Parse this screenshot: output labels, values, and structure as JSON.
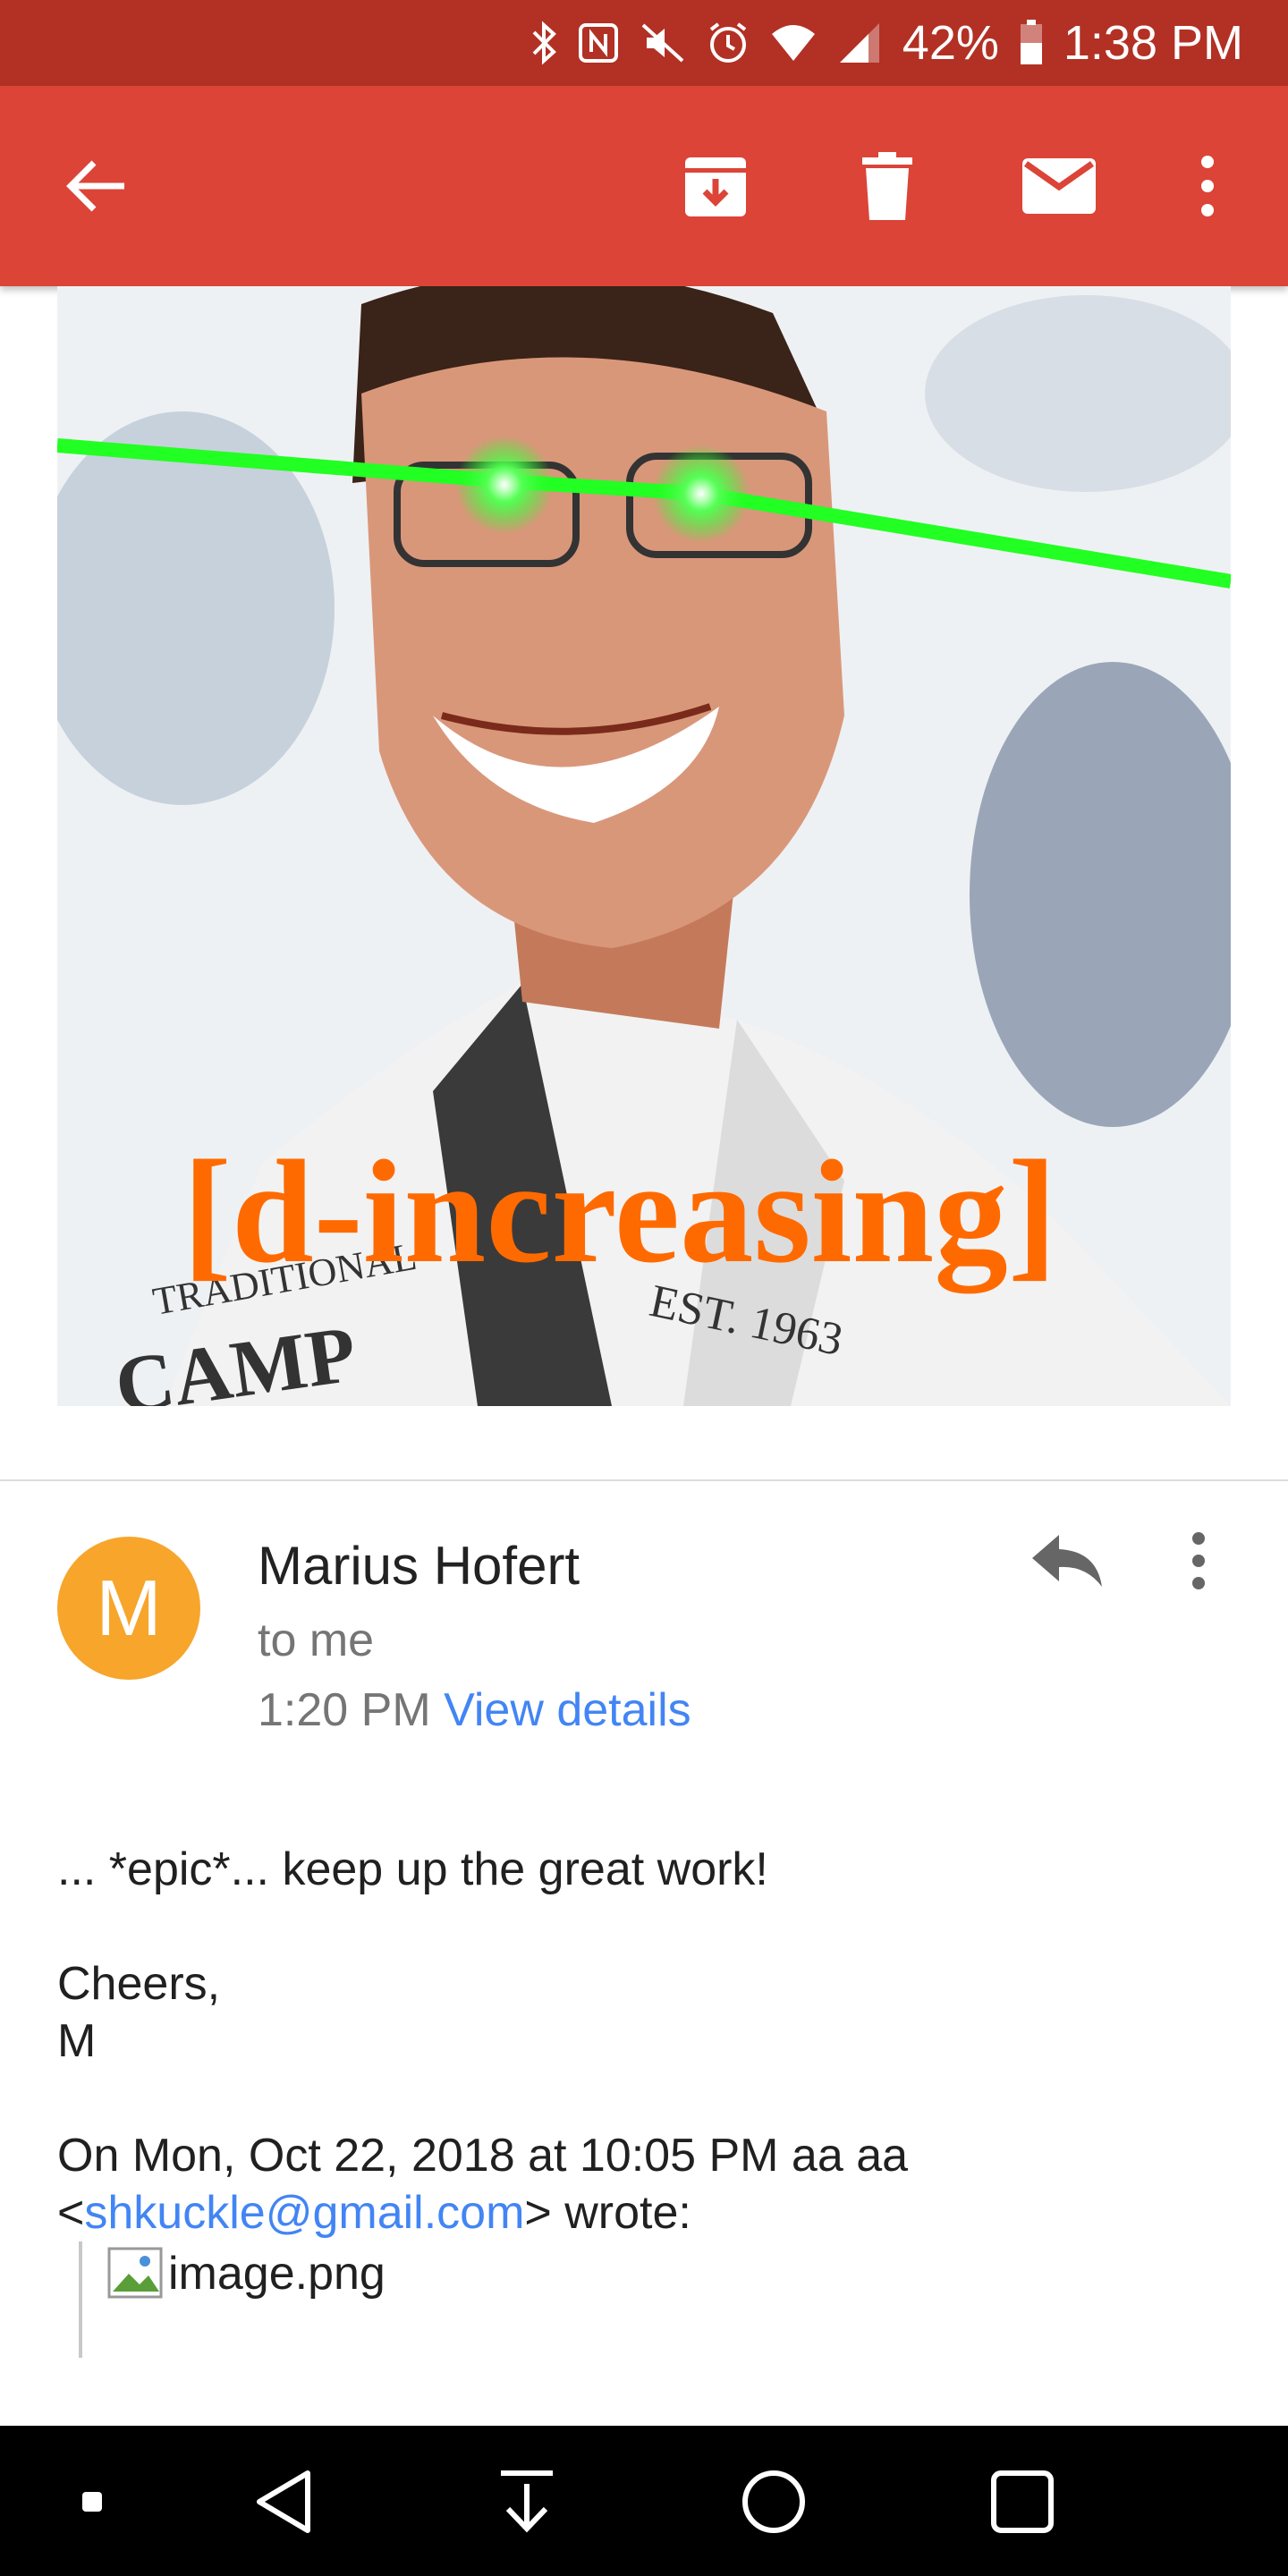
{
  "status_bar": {
    "battery": "42%",
    "time": "1:38 PM",
    "icons": [
      "bluetooth-icon",
      "nfc-icon",
      "vibrate-mute-icon",
      "alarm-icon",
      "wifi-icon",
      "signal-icon",
      "battery-icon"
    ]
  },
  "app_bar": {
    "icons": [
      "back-arrow-icon",
      "archive-icon",
      "delete-icon",
      "mark-unread-icon",
      "more-vert-icon"
    ]
  },
  "meme_image": {
    "caption": "[d-increasing]",
    "shirt_text_1": "TRADITIONAL",
    "shirt_text_2": "EST. 1963",
    "shirt_text_3": "CAMP",
    "laser_color": "#22ff22",
    "caption_color": "#ff6a00"
  },
  "message": {
    "avatar_letter": "M",
    "avatar_color": "#f7a52b",
    "sender": "Marius Hofert",
    "recipient": "to me",
    "time": "1:20 PM",
    "view_details": "View details",
    "body_line1": "... *epic*... keep up the great work!",
    "body_line2": "Cheers,",
    "body_line3": "M",
    "quote_header_line1": "On Mon, Oct 22, 2018 at 10:05 PM aa aa",
    "quote_lt": "<",
    "quote_email": "shkuckle@gmail.com",
    "quote_gt_wrote": "> wrote:",
    "quoted_image_alt": "image.png"
  },
  "nav_bar": {
    "icons": [
      "square-dot-icon",
      "back-triangle-icon",
      "download-arrow-icon",
      "home-circle-icon",
      "recents-square-icon"
    ]
  },
  "colors": {
    "status_bar": "#b23124",
    "app_bar": "#db4437",
    "link": "#4285f4"
  }
}
